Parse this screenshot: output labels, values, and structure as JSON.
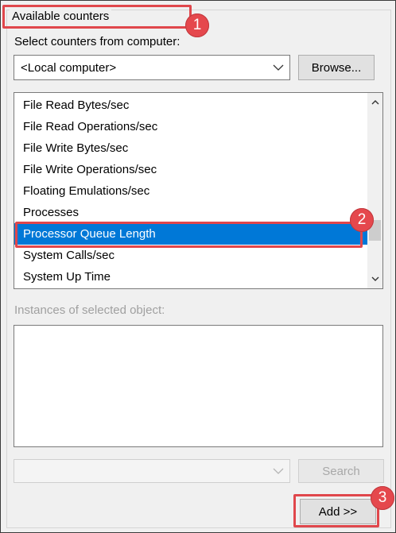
{
  "group": {
    "title": "Available counters"
  },
  "computer": {
    "label": "Select counters from computer:",
    "value": "<Local computer>",
    "browse_label": "Browse..."
  },
  "counters": {
    "items": [
      "File Read Bytes/sec",
      "File Read Operations/sec",
      "File Write Bytes/sec",
      "File Write Operations/sec",
      "Floating Emulations/sec",
      "Processes",
      "Processor Queue Length",
      "System Calls/sec",
      "System Up Time"
    ],
    "selected_index": 6
  },
  "instances": {
    "label": "Instances of selected object:"
  },
  "search": {
    "value": "",
    "button_label": "Search"
  },
  "add": {
    "label": "Add >>"
  },
  "callouts": [
    "1",
    "2",
    "3"
  ],
  "colors": {
    "callout": "#e5484d",
    "selection": "#0078d7"
  }
}
